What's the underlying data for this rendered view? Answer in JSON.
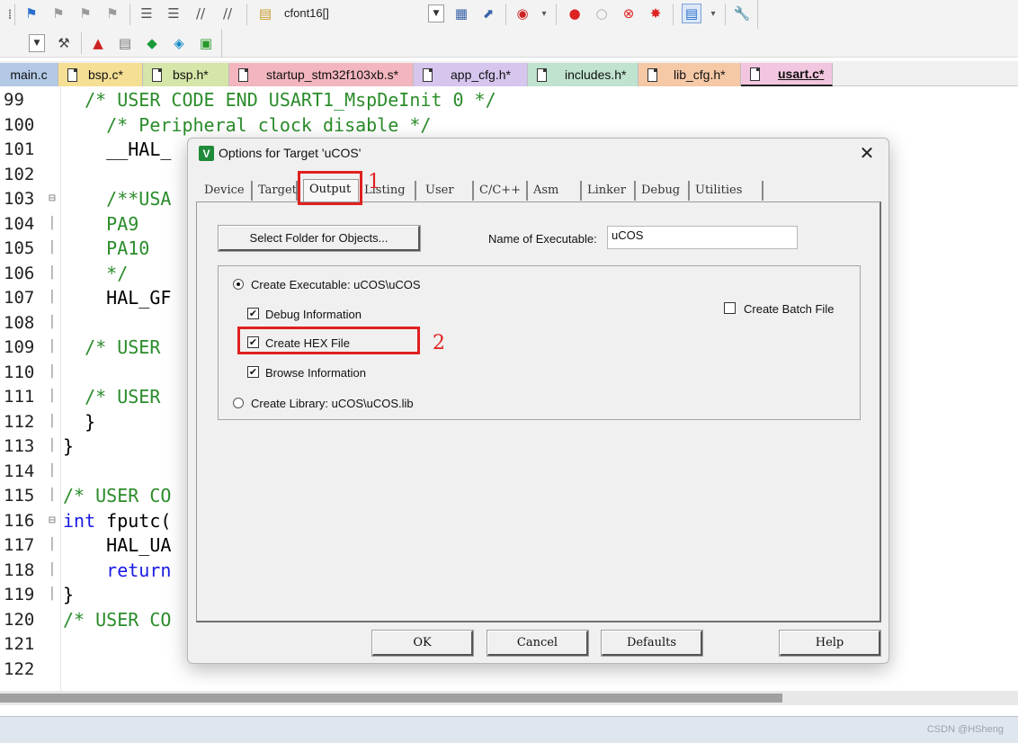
{
  "toolbar1": {
    "combo_value": "cfont16[]"
  },
  "file_tabs": [
    {
      "label": "main.c",
      "color": "#b3c9e6"
    },
    {
      "label": "bsp.c*",
      "color": "#f5df94"
    },
    {
      "label": "bsp.h*",
      "color": "#d6e6a8"
    },
    {
      "label": "startup_stm32f103xb.s*",
      "color": "#f3b6be"
    },
    {
      "label": "app_cfg.h*",
      "color": "#d6c6ee"
    },
    {
      "label": "includes.h*",
      "color": "#bfe3cf"
    },
    {
      "label": "lib_cfg.h*",
      "color": "#f5c8a6"
    },
    {
      "label": "usart.c*",
      "color": "#f3c6df"
    }
  ],
  "editor": {
    "line_numbers": [
      "99",
      "100",
      "101",
      "102",
      "103",
      "104",
      "105",
      "106",
      "107",
      "108",
      "109",
      "110",
      "111",
      "112",
      "113",
      "114",
      "115",
      "116",
      "117",
      "118",
      "119",
      "120",
      "121",
      "122"
    ],
    "lines": [
      {
        "indent": "  ",
        "text": "/* USER CODE END USART1_MspDeInit 0 */",
        "cls": "cm"
      },
      {
        "indent": "    ",
        "text": "/* Peripheral clock disable */",
        "cls": "cm"
      },
      {
        "indent": "    ",
        "text": "__HAL_",
        "cls": ""
      },
      {
        "indent": "",
        "text": "",
        "cls": ""
      },
      {
        "indent": "    ",
        "text": "/**USA",
        "cls": "cm"
      },
      {
        "indent": "    ",
        "text": "PA9",
        "cls": "cm"
      },
      {
        "indent": "    ",
        "text": "PA10",
        "cls": "cm"
      },
      {
        "indent": "    ",
        "text": "*/",
        "cls": "cm"
      },
      {
        "indent": "    ",
        "text": "HAL_GF",
        "cls": ""
      },
      {
        "indent": "",
        "text": "",
        "cls": ""
      },
      {
        "indent": "  ",
        "text": "/* USER",
        "cls": "cm"
      },
      {
        "indent": "",
        "text": "",
        "cls": ""
      },
      {
        "indent": "  ",
        "text": "/* USER",
        "cls": "cm"
      },
      {
        "indent": "  ",
        "text": "}",
        "cls": ""
      },
      {
        "indent": "",
        "text": "}",
        "cls": ""
      },
      {
        "indent": "",
        "text": "",
        "cls": ""
      },
      {
        "indent": "",
        "text": "/* USER CO",
        "cls": "cm"
      },
      {
        "indent": "",
        "text": "int fputc(",
        "cls": "mixed"
      },
      {
        "indent": "    ",
        "text": "HAL_UA",
        "cls": ""
      },
      {
        "indent": "    ",
        "text": "return",
        "cls": "kw"
      },
      {
        "indent": "",
        "text": "}",
        "cls": ""
      },
      {
        "indent": "",
        "text": "/* USER CO",
        "cls": "cm"
      },
      {
        "indent": "",
        "text": "",
        "cls": ""
      },
      {
        "indent": "",
        "text": "",
        "cls": ""
      }
    ]
  },
  "dialog": {
    "title": "Options for Target 'uCOS'",
    "tabs": [
      "Device",
      "Target",
      "Output",
      "Listing",
      "User",
      "C/C++",
      "Asm",
      "Linker",
      "Debug",
      "Utilities"
    ],
    "active_tab": "Output",
    "select_folder_label": "Select Folder for Objects...",
    "name_exec_label": "Name of Executable:",
    "name_exec_value": "uCOS",
    "create_exec_label": "Create Executable:  uCOS\\uCOS",
    "debug_info_label": "Debug Information",
    "create_hex_label": "Create HEX File",
    "browse_info_label": "Browse Information",
    "create_lib_label": "Create Library:  uCOS\\uCOS.lib",
    "create_batch_label": "Create Batch File",
    "debug_info_checked": true,
    "create_hex_checked": true,
    "browse_info_checked": true,
    "create_batch_checked": false,
    "ok_label": "OK",
    "cancel_label": "Cancel",
    "defaults_label": "Defaults",
    "help_label": "Help"
  },
  "annotations": {
    "marker1": "1",
    "marker2": "2"
  },
  "watermark": "CSDN @HSheng"
}
